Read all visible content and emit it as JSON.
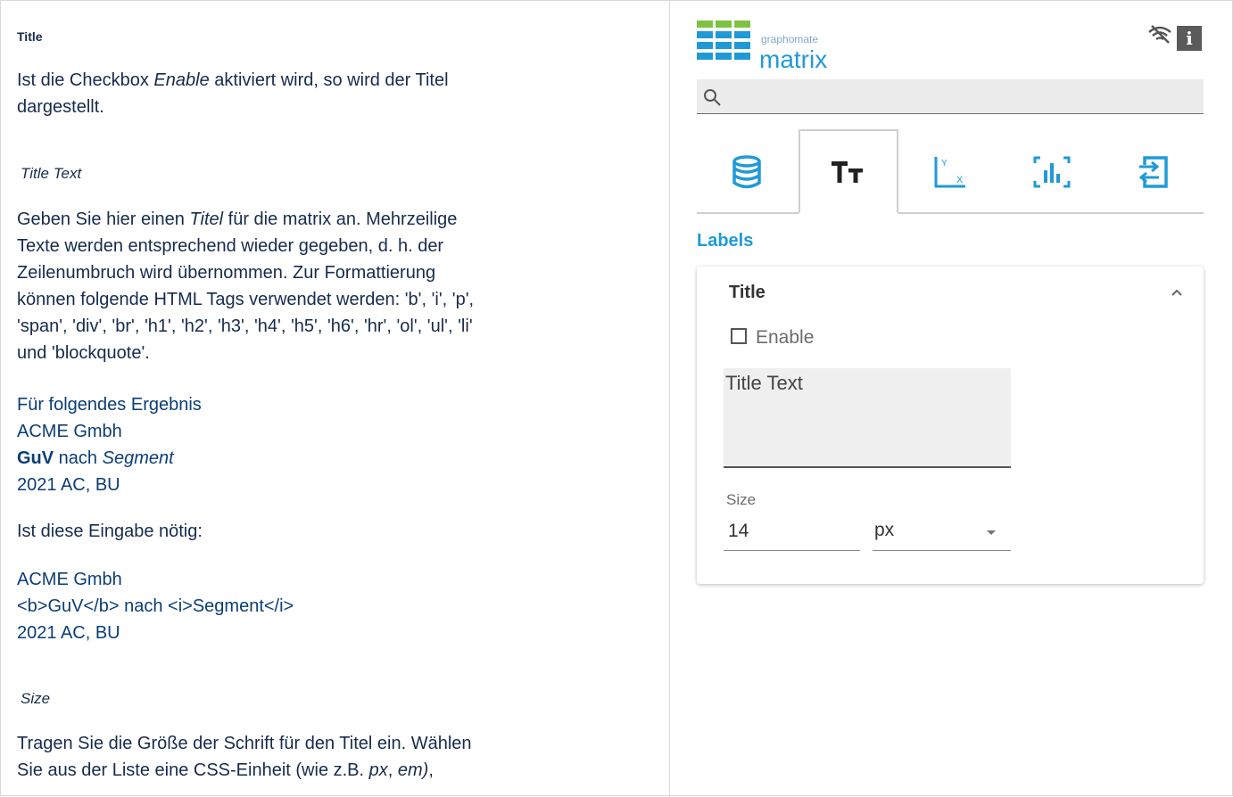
{
  "doc": {
    "heading": "Title",
    "p1": {
      "a": "Ist die Checkbox ",
      "b": "Enable",
      "c": " aktiviert wird, so wird der Titel",
      "d": "dargestellt."
    },
    "sub1": "Title Text",
    "p2": {
      "l1a": "Geben Sie hier einen ",
      "l1b": "Titel",
      "l1c": " für die matrix an. Mehrzeilige",
      "l2": "Texte werden entsprechend wieder gegeben, d. h. der",
      "l3": "Zeilenumbruch wird übernommen. Zur Formattierung",
      "l4": "können folgende HTML Tags verwendet werden: 'b', 'i', 'p',",
      "l5": "'span', 'div', 'br', 'h1', 'h2', 'h3', 'h4', 'h5', 'h6', 'hr', 'ol', 'ul', 'li'",
      "l6": "und 'blockquote'."
    },
    "ex1": {
      "l1": "Für folgendes Ergebnis",
      "l2": "ACME Gmbh",
      "l3a": "GuV",
      "l3b": " nach ",
      "l3c": "Segment",
      "l4": "2021 AC, BU"
    },
    "p3": "Ist diese Eingabe nötig:",
    "ex2": {
      "l1": "ACME Gmbh",
      "l2": "<b>GuV</b> nach <i>Segment</i>",
      "l3": "2021 AC, BU"
    },
    "sub2": "Size",
    "p4": {
      "l1": "Tragen Sie die Größe der Schrift für den Titel ein. Wählen",
      "l2a": "Sie aus der Liste eine CSS-Einheit (wie z.B. ",
      "l2b": "px",
      "l2c": ", ",
      "l2d": "em)",
      "l2e": ","
    }
  },
  "panel": {
    "logo_small": "graphomate",
    "logo_big": "matrix",
    "info_label": "i",
    "search": {
      "value": "",
      "placeholder": ""
    },
    "tabs": [
      {
        "icon": "database-icon",
        "active": false
      },
      {
        "icon": "text-size-icon",
        "active": true
      },
      {
        "icon": "axis-icon",
        "active": false
      },
      {
        "icon": "chart-focus-icon",
        "active": false
      },
      {
        "icon": "export-icon",
        "active": false
      }
    ],
    "section_title": "Labels",
    "card": {
      "title": "Title",
      "enable_label": "Enable",
      "enable_checked": false,
      "title_text_value": "Title Text",
      "size_label": "Size",
      "size_value": "14",
      "unit_value": "px"
    },
    "colors": {
      "accent": "#1f9ad7",
      "logo_green": "#7fc241",
      "info_bg": "#5a5a5a"
    }
  }
}
